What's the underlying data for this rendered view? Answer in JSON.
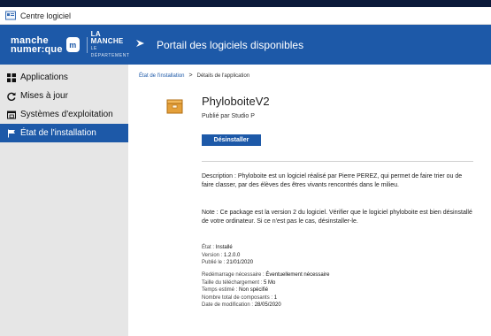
{
  "window": {
    "title": "Centre logiciel",
    "icon": "software-center-icon"
  },
  "header": {
    "brand_line1": "manche",
    "brand_line2": "numer:que",
    "brand_badge": "m",
    "partner_line1": "LA MANCHE",
    "partner_line2": "LE DÉPARTEMENT",
    "portal_title": "Portail des logiciels disponibles",
    "color": "#1d59a8"
  },
  "sidebar": {
    "items": [
      {
        "label": "Applications",
        "icon": "grid-icon",
        "active": false
      },
      {
        "label": "Mises à jour",
        "icon": "refresh-icon",
        "active": false
      },
      {
        "label": "Systèmes d'exploitation",
        "icon": "window-icon",
        "active": false
      },
      {
        "label": "État de l'installation",
        "icon": "flag-icon",
        "active": true
      }
    ]
  },
  "breadcrumb": {
    "parent": "État de l'installation",
    "separator": ">",
    "current": "Détails de l'application"
  },
  "app": {
    "name": "PhyloboiteV2",
    "publisher": "Publié par Studio P",
    "icon": "package-box-icon",
    "uninstall_label": "Désinstaller",
    "description": "Description : Phyloboite est un logiciel réalisé par Pierre PEREZ, qui permet de faire trier ou de faire classer, par des élèves des êtres vivants rencontrés dans le milieu.",
    "note": "Note : Ce package est la version 2 du logiciel. Vérifier que le logiciel phyloboite est bien désinstallé de votre ordinateur. Si ce n'est pas le cas, désinstaller-le."
  },
  "details_group1": [
    {
      "label": "État :",
      "value": "Installé"
    },
    {
      "label": "Version :",
      "value": "1.2.0.0"
    },
    {
      "label": "Publié le :",
      "value": "21/01/2020"
    }
  ],
  "details_group2": [
    {
      "label": "Redémarrage nécessaire :",
      "value": "Éventuellement nécessaire"
    },
    {
      "label": "Taille du téléchargement :",
      "value": "5 Mo"
    },
    {
      "label": "Temps estimé :",
      "value": "Non spécifié"
    },
    {
      "label": "Nombre total de composants :",
      "value": "1"
    },
    {
      "label": "Date de modification :",
      "value": "28/05/2020"
    }
  ]
}
